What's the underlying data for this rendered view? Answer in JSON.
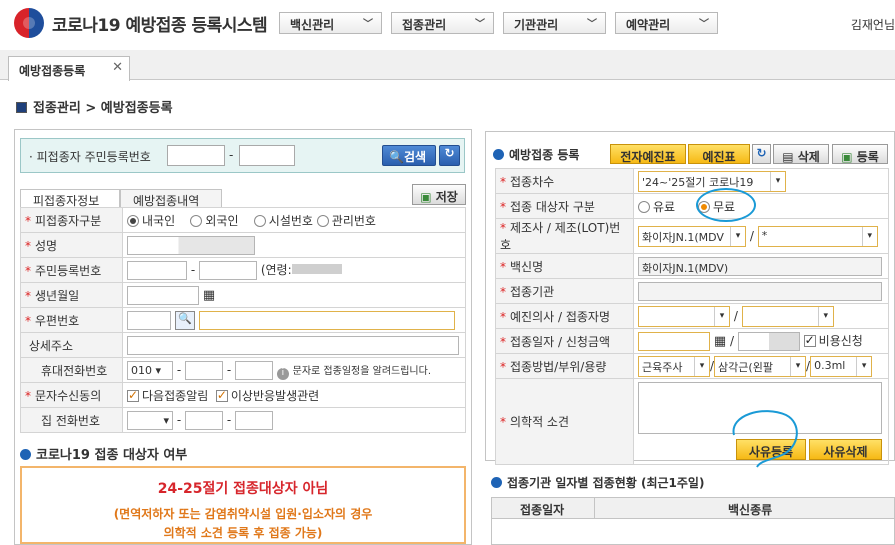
{
  "app": {
    "title": "코로나19 예방접종 등록시스템",
    "user": "김재언님"
  },
  "topmenu": [
    {
      "label": "백신관리"
    },
    {
      "label": "접종관리"
    },
    {
      "label": "기관관리"
    },
    {
      "label": "예약관리"
    }
  ],
  "tab": {
    "label": "예방접종등록"
  },
  "breadcrumb": "접종관리 > 예방접종등록",
  "search": {
    "label": "· 피접종자 주민등록번호",
    "button": "검색",
    "separator": "-"
  },
  "left": {
    "subtabs": [
      "피접종자정보",
      "예방접종내역"
    ],
    "save": "저장",
    "rows": {
      "type": {
        "label": "피접종자구분",
        "options": [
          "내국인",
          "외국인",
          "시설번호",
          "관리번호"
        ]
      },
      "name": {
        "label": "성명"
      },
      "rrn": {
        "label": "주민등록번호",
        "age": "(연령:",
        "sep": "-"
      },
      "birth": {
        "label": "생년월일"
      },
      "zip": {
        "label": "우편번호"
      },
      "addr": {
        "label": "상세주소"
      },
      "mobile": {
        "label": "휴대전화번호",
        "prefix": "010",
        "note": "문자로 접종일정을 알려드립니다.",
        "sep": "-"
      },
      "sms": {
        "label": "문자수신동의",
        "opt1": "다음접종알림",
        "opt2": "이상반응발생관련"
      },
      "home": {
        "label": "집 전화번호",
        "sep": "-"
      }
    },
    "target_section": "코로나19 접종 대상자 여부",
    "notice": {
      "title": "24-25절기 접종대상자 아님",
      "line1": "(면역저하자 또는 감염취약시설 입원·입소자의 경우",
      "line2": "의학적 소견 등록 후 접종 가능)"
    }
  },
  "right": {
    "section": "예방접종 등록",
    "buttons": {
      "echart": "전자예진표",
      "chart": "예진표",
      "delete": "삭제",
      "register": "등록"
    },
    "rows": {
      "dose": {
        "label": "접종차수",
        "value": "'24~'25절기 코로나19"
      },
      "target": {
        "label": "접종 대상자 구분",
        "paid": "유료",
        "free": "무료"
      },
      "maker": {
        "label": "제조사 / 제조(LOT)번호",
        "value": "화이자JN.1(MDV",
        "lot": "*"
      },
      "vaccine": {
        "label": "백신명",
        "value": "화이자JN.1(MDV)"
      },
      "org": {
        "label": "접종기관"
      },
      "doctor": {
        "label": "예진의사 / 접종자명"
      },
      "date": {
        "label": "접종일자 / 신청금액",
        "nonpay": "비용신청"
      },
      "method": {
        "label": "접종방법/부위/용량",
        "route": "근육주사",
        "site": "삼각근(왼팔",
        "volume": "0.3ml"
      },
      "opinion": {
        "label": "의학적 소견",
        "reg": "사유등록",
        "del": "사유삭제"
      }
    },
    "history": {
      "title": "접종기관 일자별 접종현황 (최근1주일)",
      "col1": "접종일자",
      "col2": "백신종류"
    },
    "slash": "/"
  }
}
